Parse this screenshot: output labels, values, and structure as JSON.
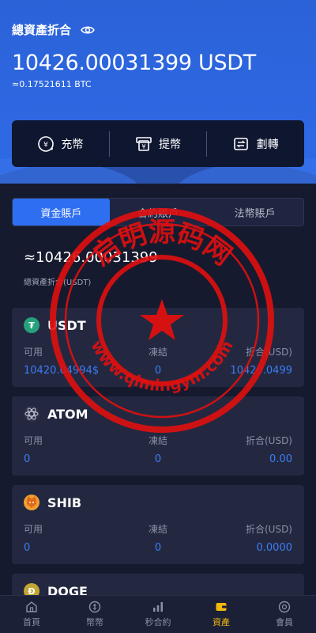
{
  "hero": {
    "title": "總資產折合",
    "total_amount": "10426.00031399 USDT",
    "total_btc": "≈0.17521611 BTC"
  },
  "actions": [
    {
      "label": "充幣",
      "icon": "deposit-icon"
    },
    {
      "label": "提幣",
      "icon": "withdraw-icon"
    },
    {
      "label": "劃轉",
      "icon": "transfer-icon"
    }
  ],
  "tabs": [
    {
      "label": "資金賬戶",
      "active": true
    },
    {
      "label": "合約賬戶",
      "active": false
    },
    {
      "label": "法幣賬戶",
      "active": false
    }
  ],
  "account": {
    "total": "≈10426.00031399",
    "sub": "總資產折合(USDT)"
  },
  "columns": {
    "available": "可用",
    "frozen": "凍結",
    "converted": "折合(USD)"
  },
  "coins": [
    {
      "name": "USDT",
      "available": "10420.04994$",
      "frozen": "0",
      "converted": "10420.0499",
      "color": "#26a17b"
    },
    {
      "name": "ATOM",
      "available": "0",
      "frozen": "0",
      "converted": "0.00",
      "color": "#2e3148"
    },
    {
      "name": "SHIB",
      "available": "0",
      "frozen": "0",
      "converted": "0.0000",
      "color": "#f0a033"
    },
    {
      "name": "DOGE",
      "color": "#c2a633"
    }
  ],
  "nav": [
    {
      "label": "首頁",
      "icon": "home-icon",
      "active": false
    },
    {
      "label": "幣幣",
      "icon": "coin-icon",
      "active": false
    },
    {
      "label": "秒合約",
      "icon": "chart-icon",
      "active": false
    },
    {
      "label": "資產",
      "icon": "wallet-icon",
      "active": true
    },
    {
      "label": "會員",
      "icon": "member-icon",
      "active": false
    }
  ],
  "watermark": {
    "text": "启明源码网",
    "url": "www.qimingym.com",
    "color": "#e01010"
  }
}
